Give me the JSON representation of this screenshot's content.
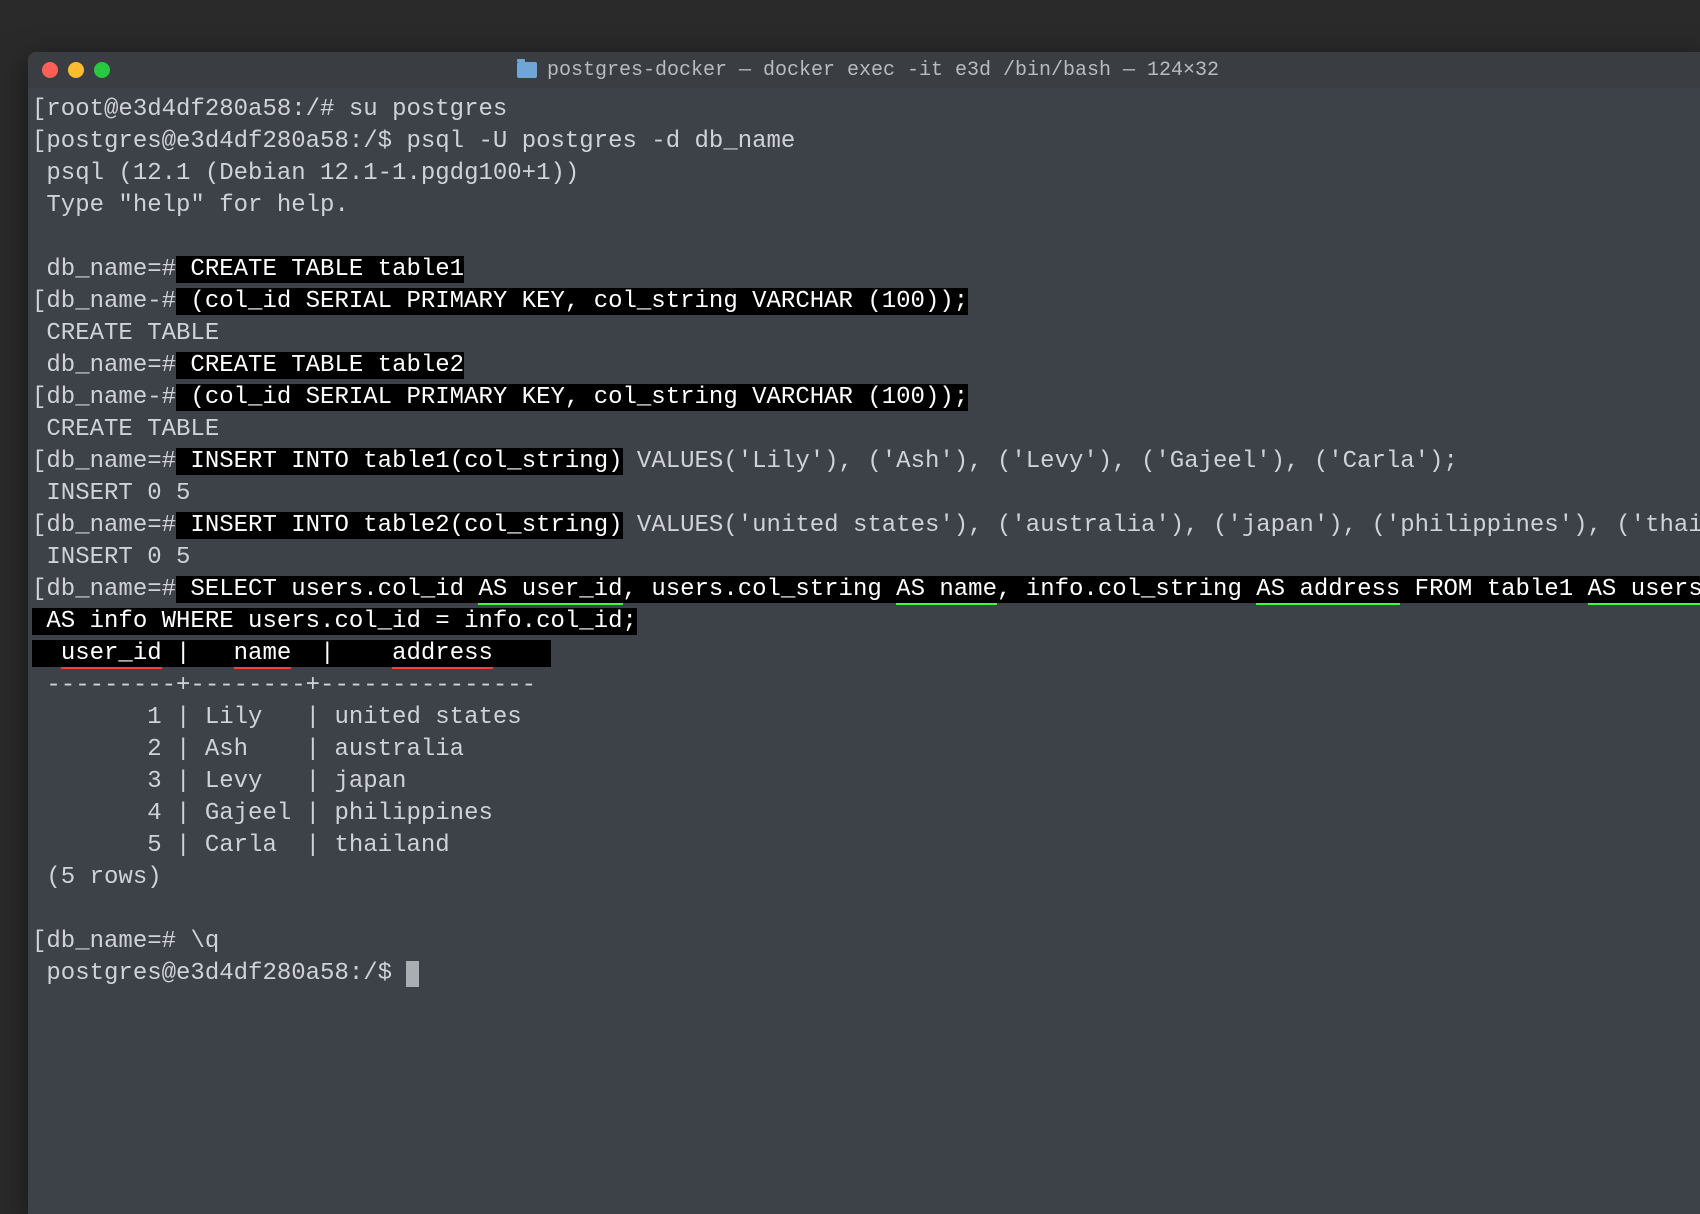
{
  "window": {
    "title": "postgres-docker — docker exec -it e3d /bin/bash — 124×32"
  },
  "lines": {
    "l1_prompt": "[root@e3d4df280a58:/# ",
    "l1_cmd": "su postgres",
    "l2_prompt": "[postgres@e3d4df280a58:/$ ",
    "l2_cmd": "psql -U postgres -d db_name",
    "l3": " psql (12.1 (Debian 12.1-1.pgdg100+1))",
    "l4": " Type \"help\" for help.",
    "l5_prompt": " db_name=#",
    "l5_hl": " CREATE TABLE table1",
    "l6_prompt": "[db_name-#",
    "l6_hl": " (col_id SERIAL PRIMARY KEY, col_string VARCHAR (100));",
    "l7": " CREATE TABLE",
    "l8_prompt": " db_name=#",
    "l8_hl": " CREATE TABLE table2",
    "l9_prompt": "[db_name-#",
    "l9_hl": " (col_id SERIAL PRIMARY KEY, col_string VARCHAR (100));",
    "l10": " CREATE TABLE",
    "l11_prompt": "[db_name=#",
    "l11_hl": " INSERT INTO table1(col_string)",
    "l11_rest": " VALUES('Lily'), ('Ash'), ('Levy'), ('Gajeel'), ('Carla');",
    "l12": " INSERT 0 5",
    "l13_prompt": "[db_name=#",
    "l13_hl": " INSERT INTO table2(col_string)",
    "l13_rest": " VALUES('united states'), ('australia'), ('japan'), ('philippines'), ('thaila",
    "l14": " INSERT 0 5",
    "l15_prompt": "[db_name=#",
    "l15_a": " SELECT users.col_id ",
    "l15_as_userid": "AS user_id",
    "l15_b": ", users.col_string ",
    "l15_as_name": "AS name",
    "l15_c": ", info.col_string ",
    "l15_as_address": "AS address",
    "l15_d": " FROM table1 ",
    "l15_as_users": "AS users",
    "l15_e": ",",
    "l16": " AS info WHERE users.col_id = info.col_id;",
    "hdr_sp1": "  ",
    "hdr_user_id": "user_id",
    "hdr_sp2": " |   ",
    "hdr_name": "name",
    "hdr_sp3": "  |    ",
    "hdr_address": "address",
    "hdr_sp4": "    ",
    "divider": " ---------+--------+---------------",
    "row1": "        1 | Lily   | united states",
    "row2": "        2 | Ash    | australia",
    "row3": "        3 | Levy   | japan",
    "row4": "        4 | Gajeel | philippines",
    "row5": "        5 | Carla  | thailand",
    "rows_footer": " (5 rows)",
    "quit_prompt": "[db_name=# ",
    "quit_cmd": "\\q",
    "final_prompt": " postgres@e3d4df280a58:/$ "
  },
  "query_result": {
    "columns": [
      "user_id",
      "name",
      "address"
    ],
    "rows": [
      [
        1,
        "Lily",
        "united states"
      ],
      [
        2,
        "Ash",
        "australia"
      ],
      [
        3,
        "Levy",
        "japan"
      ],
      [
        4,
        "Gajeel",
        "philippines"
      ],
      [
        5,
        "Carla",
        "thailand"
      ]
    ],
    "row_count": 5
  }
}
